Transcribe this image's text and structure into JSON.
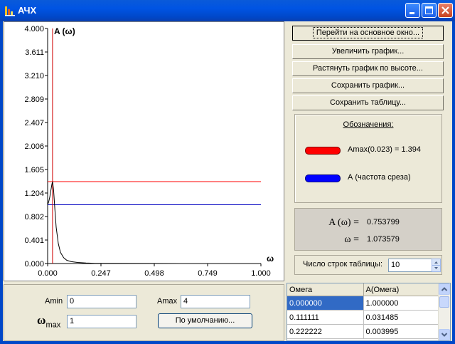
{
  "window": {
    "title": "АЧХ",
    "icon": "chart-app-icon"
  },
  "plot": {
    "y_axis_label": "A (ω)",
    "x_axis_label": "ω",
    "y_ticks": [
      "4.000",
      "3.611",
      "3.210",
      "2.809",
      "2.407",
      "2.006",
      "1.605",
      "1.204",
      "0.802",
      "0.401",
      "0.000"
    ],
    "x_ticks": [
      "0.000",
      "0.247",
      "0.498",
      "0.749",
      "1.000"
    ],
    "colors": {
      "amax_line": "#ff0000",
      "cutoff_line": "#0000c0",
      "curve": "#000000",
      "marker_line": "#d00000"
    }
  },
  "chart_data": {
    "type": "line",
    "title": "",
    "xlabel": "ω",
    "ylabel": "A (ω)",
    "xlim": [
      0,
      1
    ],
    "ylim": [
      0,
      4
    ],
    "series": [
      {
        "x": [
          0.0,
          0.005,
          0.01,
          0.015,
          0.02,
          0.023,
          0.028,
          0.034,
          0.04,
          0.05,
          0.06,
          0.075,
          0.09,
          0.111,
          0.14,
          0.18,
          0.222,
          0.3,
          0.5,
          0.75,
          1.0
        ],
        "y": [
          1.0,
          1.05,
          1.13,
          1.24,
          1.35,
          1.394,
          1.25,
          0.92,
          0.62,
          0.34,
          0.19,
          0.1,
          0.055,
          0.031,
          0.018,
          0.008,
          0.004,
          0.002,
          0.001,
          0.0005,
          0.0002
        ]
      }
    ],
    "hlines": [
      {
        "name": "Amax(0.023) = 1.394",
        "y": 1.394
      },
      {
        "name": "A (частота среза)",
        "y": 1.0
      }
    ],
    "vline_x": 0.023
  },
  "buttons": {
    "goto_main": "Перейти на основное окно...",
    "zoom": "Увеличить график...",
    "stretch": "Растянуть график по высоте...",
    "save_graph": "Сохранить график...",
    "save_table": "Сохранить таблицу...",
    "defaults": "По умолчанию..."
  },
  "legend": {
    "title": "Обозначения:",
    "amax_label": "Amax(0.023) = 1.394",
    "amax_color": "#ff0000",
    "cutoff_label": "А (частота среза)",
    "cutoff_color": "#0000ff"
  },
  "readout": {
    "a_label": "A (ω) =",
    "a_value": "0.753799",
    "w_label": "ω =",
    "w_value": "1.073579"
  },
  "rows_control": {
    "label": "Число строк таблицы:",
    "value": "10"
  },
  "params": {
    "amin_label": "Amin",
    "amin_value": "0",
    "amax_label": "Amax",
    "amax_value": "4",
    "wmax_symbol": "ω",
    "wmax_sub": "max",
    "wmax_value": "1"
  },
  "table": {
    "headers": [
      "Омега",
      "A(Омега)"
    ],
    "rows": [
      [
        "0.000000",
        "1.000000"
      ],
      [
        "0.111111",
        "0.031485"
      ],
      [
        "0.222222",
        "0.003995"
      ]
    ]
  }
}
